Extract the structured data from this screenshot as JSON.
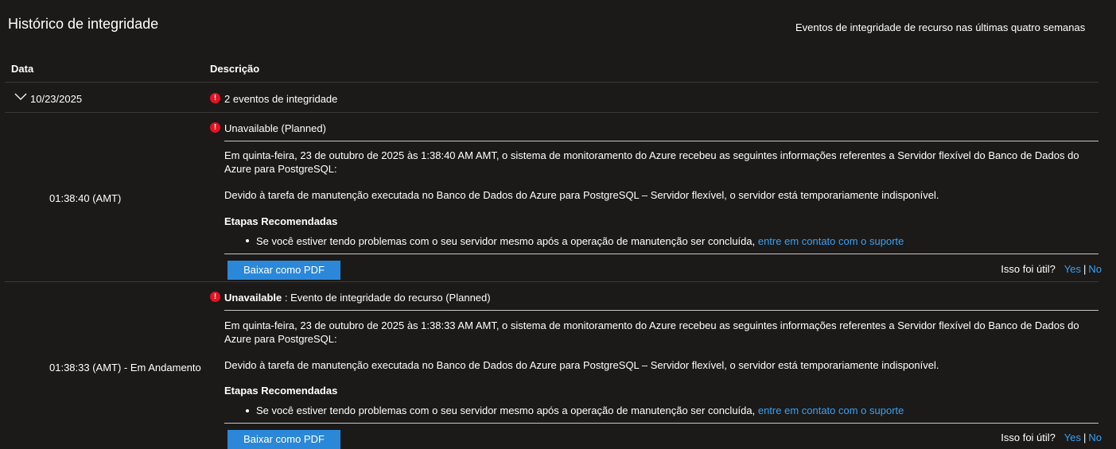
{
  "page": {
    "title": "Histórico de integridade",
    "subtitle": "Eventos de integridade de recurso nas últimas quatro semanas"
  },
  "table": {
    "col_date": "Data",
    "col_description": "Descrição"
  },
  "group": {
    "date": "10/23/2025",
    "summary": "2 eventos de integridade"
  },
  "events": [
    {
      "time": "01:38:40 (AMT)",
      "title_bold": "",
      "title": "Unavailable (Planned)",
      "body": "Em quinta-feira, 23 de outubro de 2025 às 1:38:40 AM AMT, o sistema de monitoramento do Azure recebeu as seguintes informações referentes a Servidor flexível do Banco de Dados do Azure para PostgreSQL:",
      "detail": "Devido à tarefa de manutenção executada no Banco de Dados do Azure para PostgreSQL – Servidor flexível, o servidor está temporariamente indisponível.",
      "steps_title": "Etapas Recomendadas",
      "step_text": "Se você estiver tendo problemas com o seu servidor mesmo após a operação de manutenção ser concluída, ",
      "step_link": "entre em contato com o suporte",
      "pdf_button": "Baixar como PDF",
      "feedback_q": "Isso foi útil?",
      "feedback_yes": "Yes",
      "feedback_no": "No"
    },
    {
      "time": "01:38:33 (AMT) - Em Andamento",
      "title_bold": "Unavailable",
      "title": " : Evento de integridade do recurso (Planned)",
      "body": "Em quinta-feira, 23 de outubro de 2025 às 1:38:33 AM AMT, o sistema de monitoramento do Azure recebeu as seguintes informações referentes a Servidor flexível do Banco de Dados do Azure para PostgreSQL:",
      "detail": "Devido à tarefa de manutenção executada no Banco de Dados do Azure para PostgreSQL – Servidor flexível, o servidor está temporariamente indisponível.",
      "steps_title": "Etapas Recomendadas",
      "step_text": "Se você estiver tendo problemas com o seu servidor mesmo após a operação de manutenção ser concluída, ",
      "step_link": "entre em contato com o suporte",
      "pdf_button": "Baixar como PDF",
      "feedback_q": "Isso foi útil?",
      "feedback_yes": "Yes",
      "feedback_no": "No"
    }
  ],
  "icons": {
    "status": "error-icon",
    "expand": "chevron-down-icon"
  },
  "colors": {
    "background": "#1b1a19",
    "error": "#e81123",
    "link": "#3aa0f3",
    "button": "#2b88d8"
  }
}
